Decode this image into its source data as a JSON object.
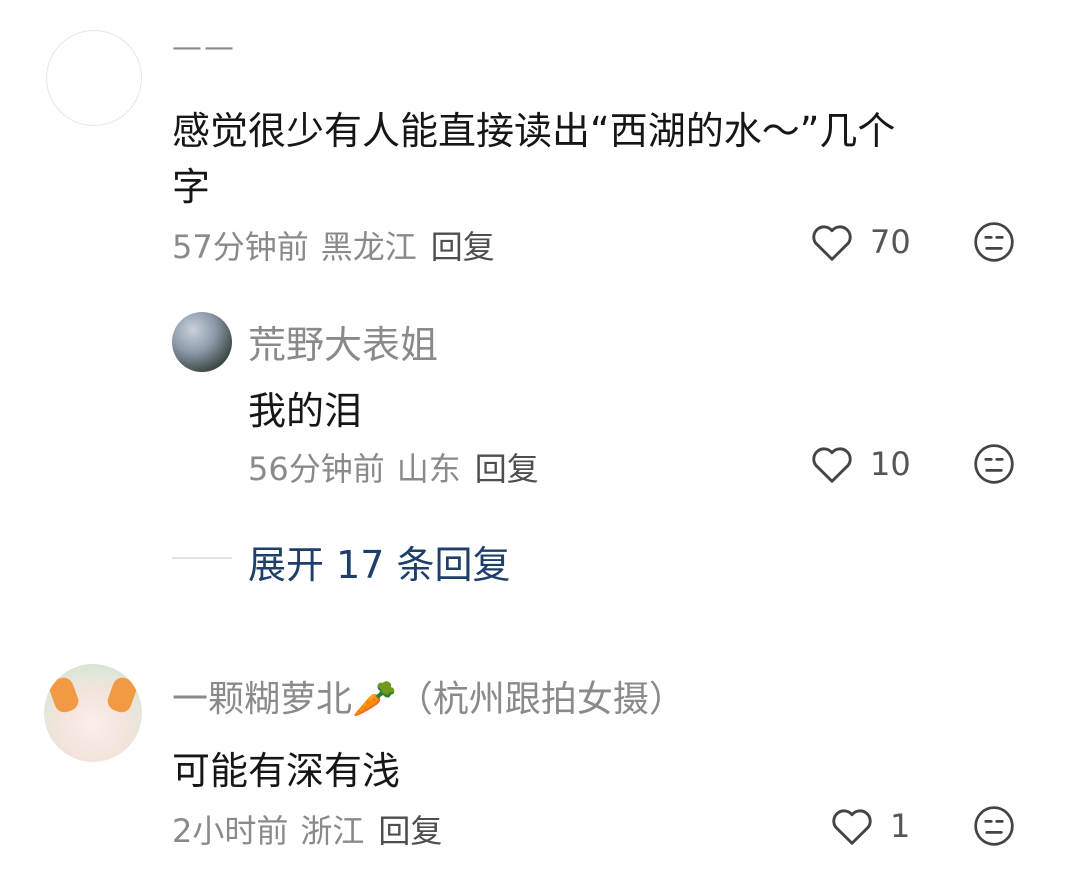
{
  "comments": [
    {
      "user": "——",
      "text_line1": "感觉很少有人能直接读出“西湖的水～”几个",
      "text_line2": "字",
      "time": "57分钟前",
      "location": "黑龙江",
      "reply_label": "回复",
      "likes": "70"
    },
    {
      "user": "荒野大表姐",
      "text": "我的泪",
      "time": "56分钟前",
      "location": "山东",
      "reply_label": "回复",
      "likes": "10"
    },
    {
      "user": "一颗糊萝北🥕（杭州跟拍女摄）",
      "text": "可能有深有浅",
      "time": "2小时前",
      "location": "浙江",
      "reply_label": "回复",
      "likes": "1"
    }
  ],
  "expand_label": "展开 17 条回复",
  "icons": {
    "like": "heart-outline-icon",
    "dislike": "meh-face-icon"
  },
  "colors": {
    "link": "#1f3f6b",
    "meta": "#8a8a8a",
    "text": "#161616"
  }
}
